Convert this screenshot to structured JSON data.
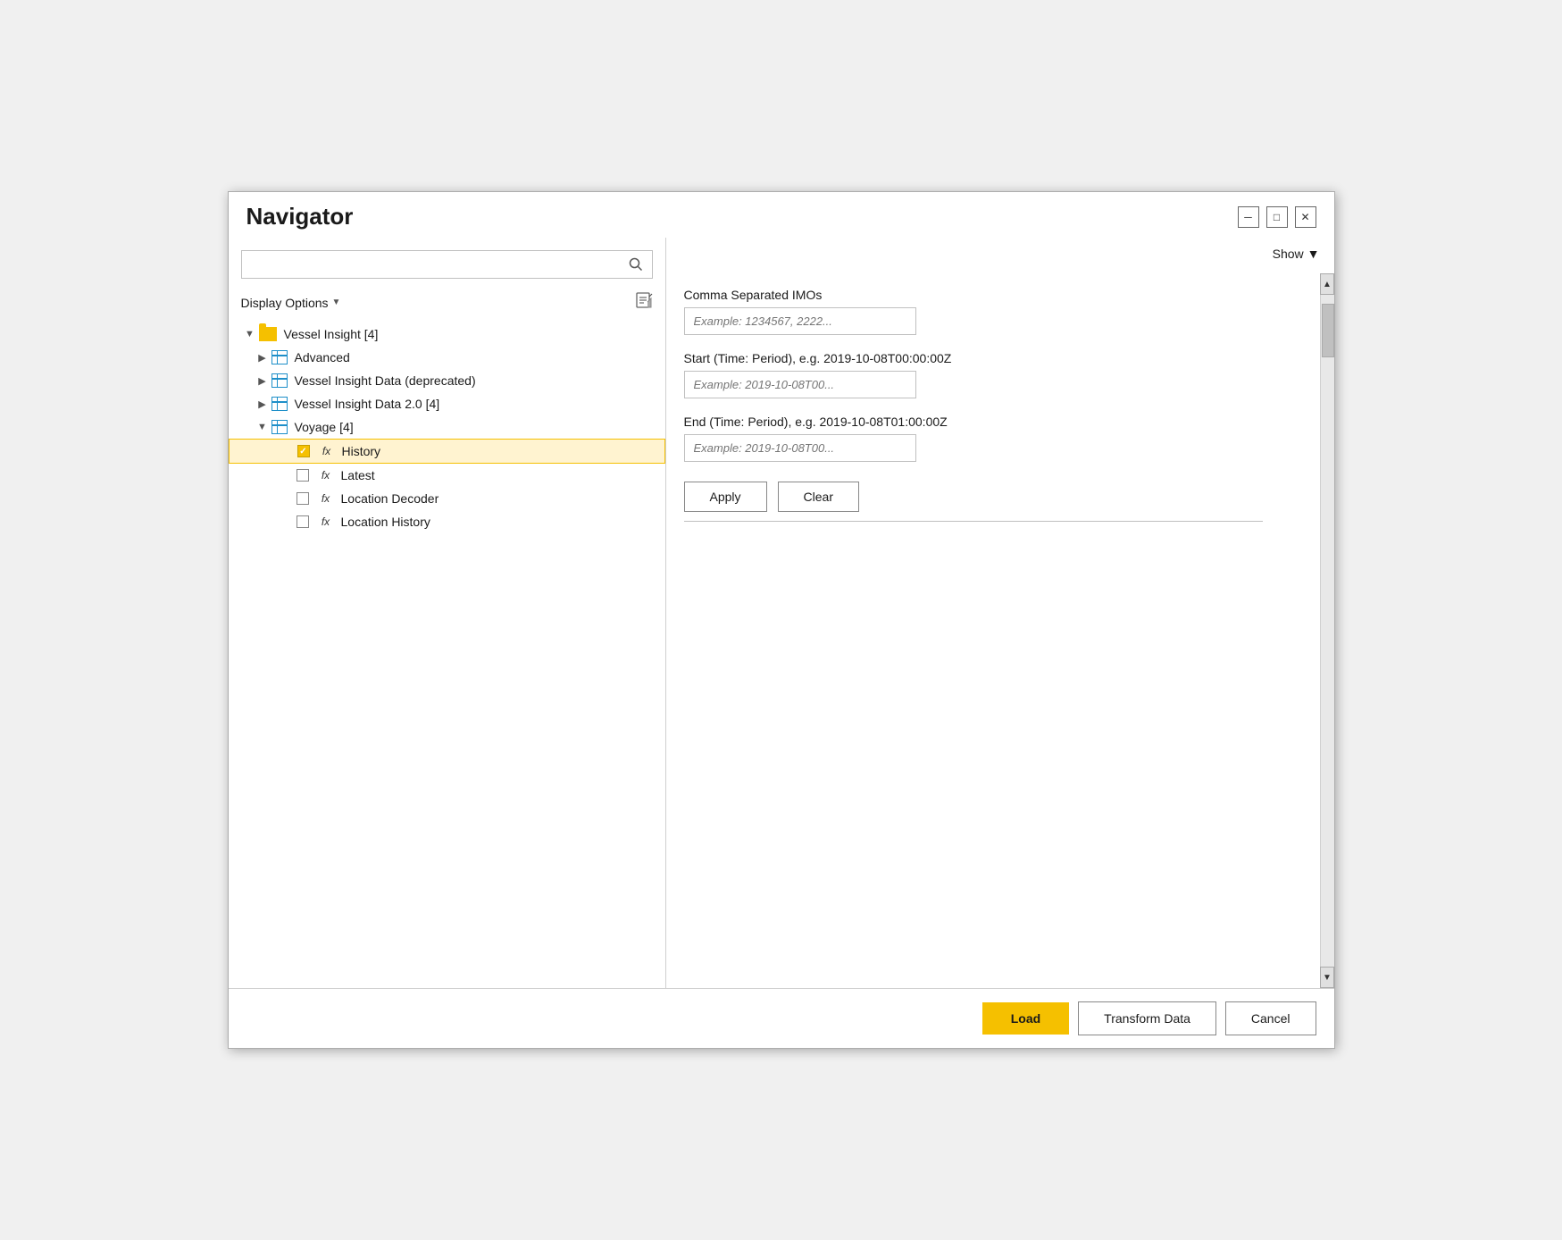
{
  "dialog": {
    "title": "Navigator"
  },
  "titleBar": {
    "minimizeLabel": "─",
    "maximizeLabel": "□",
    "closeLabel": "✕"
  },
  "leftPanel": {
    "searchPlaceholder": "",
    "displayOptionsLabel": "Display Options",
    "tree": {
      "items": [
        {
          "id": "vessel-insight",
          "label": "Vessel Insight [4]",
          "type": "folder",
          "expanded": true,
          "indent": 1,
          "children": [
            {
              "id": "advanced",
              "label": "Advanced",
              "type": "table",
              "expanded": false,
              "indent": 2
            },
            {
              "id": "vessel-insight-data-deprecated",
              "label": "Vessel Insight Data (deprecated)",
              "type": "table",
              "expanded": false,
              "indent": 2
            },
            {
              "id": "vessel-insight-data-20",
              "label": "Vessel Insight Data 2.0 [4]",
              "type": "table",
              "expanded": false,
              "indent": 2
            },
            {
              "id": "voyage",
              "label": "Voyage [4]",
              "type": "table",
              "expanded": true,
              "indent": 2,
              "children": [
                {
                  "id": "history",
                  "label": "History",
                  "type": "fx",
                  "checked": true,
                  "selected": true,
                  "indent": 3
                },
                {
                  "id": "latest",
                  "label": "Latest",
                  "type": "fx",
                  "checked": false,
                  "indent": 3
                },
                {
                  "id": "location-decoder",
                  "label": "Location Decoder",
                  "type": "fx",
                  "checked": false,
                  "indent": 3
                },
                {
                  "id": "location-history",
                  "label": "Location History",
                  "type": "fx",
                  "checked": false,
                  "indent": 3
                }
              ]
            }
          ]
        }
      ]
    }
  },
  "rightPanel": {
    "showLabel": "Show",
    "form": {
      "field1": {
        "label": "Comma Separated IMOs",
        "placeholder": "Example: 1234567, 2222..."
      },
      "field2": {
        "label": "Start (Time: Period), e.g. 2019-10-08T00:00:00Z",
        "placeholder": "Example: 2019-10-08T00..."
      },
      "field3": {
        "label": "End (Time: Period), e.g. 2019-10-08T01:00:00Z",
        "placeholder": "Example: 2019-10-08T00..."
      },
      "applyLabel": "Apply",
      "clearLabel": "Clear"
    }
  },
  "footer": {
    "loadLabel": "Load",
    "transformDataLabel": "Transform Data",
    "cancelLabel": "Cancel"
  }
}
